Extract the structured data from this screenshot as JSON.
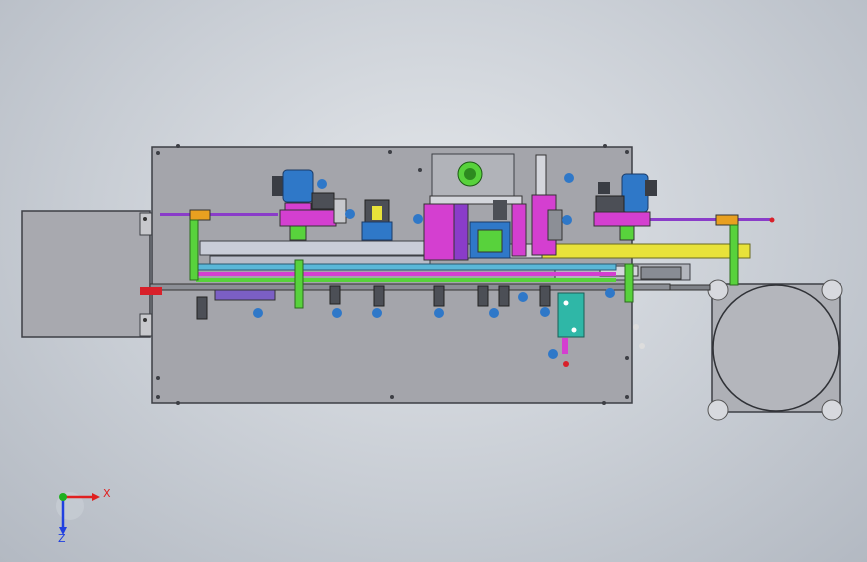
{
  "colors": {
    "background": "#c9ced5",
    "plate": "#a4a5ab",
    "plate_edge": "#3d3f45",
    "enclosure": "#a8a9af",
    "bowl": "#aeb0b6",
    "motor_blue": "#2f78c8",
    "magenta": "#d43fd0",
    "green": "#58d23c",
    "yellow": "#e8e23a",
    "teal": "#2fb7a7",
    "red": "#d8202a",
    "purple": "#8a3cc9",
    "axis_x": "#e02020",
    "axis_y": "#20b020",
    "axis_z": "#2040e0"
  },
  "icons": {
    "triad": "coordinate-triad-icon",
    "motor": "motor-icon"
  },
  "axis": {
    "x_label": "X",
    "z_label": "Z"
  }
}
